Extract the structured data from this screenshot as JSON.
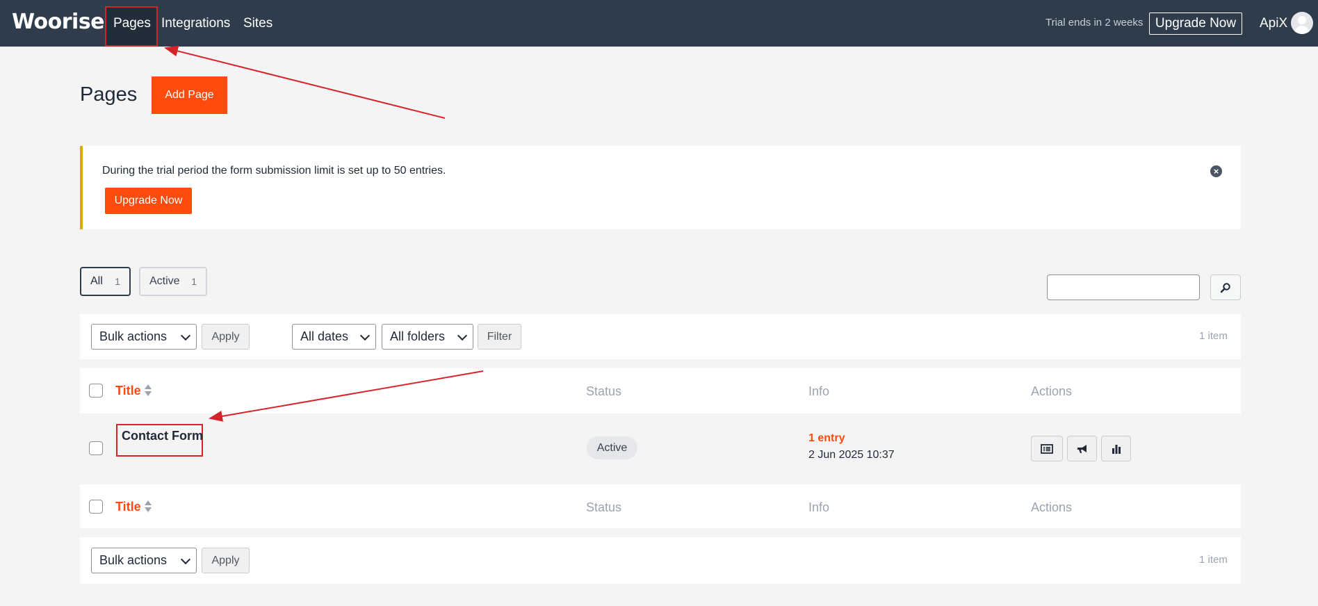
{
  "topbar": {
    "logo": "Woorise",
    "nav": [
      "Pages",
      "Integrations",
      "Sites"
    ],
    "trial_note": "Trial ends in 2 weeks",
    "upgrade_label": "Upgrade Now",
    "user_name": "ApiX"
  },
  "header": {
    "title": "Pages",
    "add_button": "Add Page"
  },
  "notice": {
    "text": "During the trial period the form submission limit is set up to 50 entries.",
    "button": "Upgrade Now"
  },
  "views": [
    {
      "label": "All",
      "count": "1"
    },
    {
      "label": "Active",
      "count": "1"
    }
  ],
  "search": {
    "placeholder": ""
  },
  "toolbar": {
    "bulk_actions": "Bulk actions",
    "apply": "Apply",
    "dates": "All dates",
    "folders": "All folders",
    "filter": "Filter",
    "item_count": "1 item"
  },
  "table": {
    "columns": [
      "Title",
      "Status",
      "Info",
      "Actions"
    ],
    "rows": [
      {
        "title": "Contact Form",
        "status": "Active",
        "info_entries": "1 entry",
        "info_date": "2 Jun 2025 10:37"
      }
    ]
  },
  "colors": {
    "topbar": "#2f3c4b",
    "accent": "#ff4b0d",
    "notice_border": "#dba617",
    "annotation": "#d6232a"
  },
  "icons": [
    "search-icon",
    "close-icon",
    "entries-icon",
    "megaphone-icon",
    "stats-icon",
    "sort-icon",
    "avatar-icon",
    "chevron-down-icon"
  ]
}
